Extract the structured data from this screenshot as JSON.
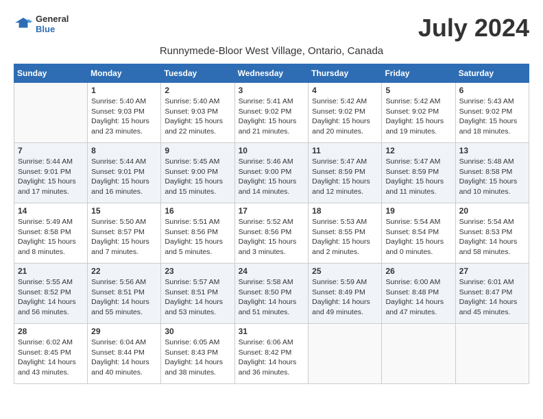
{
  "header": {
    "logo_line1": "General",
    "logo_line2": "Blue",
    "title": "July 2024",
    "subtitle": "Runnymede-Bloor West Village, Ontario, Canada"
  },
  "days_of_week": [
    "Sunday",
    "Monday",
    "Tuesday",
    "Wednesday",
    "Thursday",
    "Friday",
    "Saturday"
  ],
  "weeks": [
    [
      {
        "num": "",
        "info": ""
      },
      {
        "num": "1",
        "info": "Sunrise: 5:40 AM\nSunset: 9:03 PM\nDaylight: 15 hours\nand 23 minutes."
      },
      {
        "num": "2",
        "info": "Sunrise: 5:40 AM\nSunset: 9:03 PM\nDaylight: 15 hours\nand 22 minutes."
      },
      {
        "num": "3",
        "info": "Sunrise: 5:41 AM\nSunset: 9:02 PM\nDaylight: 15 hours\nand 21 minutes."
      },
      {
        "num": "4",
        "info": "Sunrise: 5:42 AM\nSunset: 9:02 PM\nDaylight: 15 hours\nand 20 minutes."
      },
      {
        "num": "5",
        "info": "Sunrise: 5:42 AM\nSunset: 9:02 PM\nDaylight: 15 hours\nand 19 minutes."
      },
      {
        "num": "6",
        "info": "Sunrise: 5:43 AM\nSunset: 9:02 PM\nDaylight: 15 hours\nand 18 minutes."
      }
    ],
    [
      {
        "num": "7",
        "info": "Sunrise: 5:44 AM\nSunset: 9:01 PM\nDaylight: 15 hours\nand 17 minutes."
      },
      {
        "num": "8",
        "info": "Sunrise: 5:44 AM\nSunset: 9:01 PM\nDaylight: 15 hours\nand 16 minutes."
      },
      {
        "num": "9",
        "info": "Sunrise: 5:45 AM\nSunset: 9:00 PM\nDaylight: 15 hours\nand 15 minutes."
      },
      {
        "num": "10",
        "info": "Sunrise: 5:46 AM\nSunset: 9:00 PM\nDaylight: 15 hours\nand 14 minutes."
      },
      {
        "num": "11",
        "info": "Sunrise: 5:47 AM\nSunset: 8:59 PM\nDaylight: 15 hours\nand 12 minutes."
      },
      {
        "num": "12",
        "info": "Sunrise: 5:47 AM\nSunset: 8:59 PM\nDaylight: 15 hours\nand 11 minutes."
      },
      {
        "num": "13",
        "info": "Sunrise: 5:48 AM\nSunset: 8:58 PM\nDaylight: 15 hours\nand 10 minutes."
      }
    ],
    [
      {
        "num": "14",
        "info": "Sunrise: 5:49 AM\nSunset: 8:58 PM\nDaylight: 15 hours\nand 8 minutes."
      },
      {
        "num": "15",
        "info": "Sunrise: 5:50 AM\nSunset: 8:57 PM\nDaylight: 15 hours\nand 7 minutes."
      },
      {
        "num": "16",
        "info": "Sunrise: 5:51 AM\nSunset: 8:56 PM\nDaylight: 15 hours\nand 5 minutes."
      },
      {
        "num": "17",
        "info": "Sunrise: 5:52 AM\nSunset: 8:56 PM\nDaylight: 15 hours\nand 3 minutes."
      },
      {
        "num": "18",
        "info": "Sunrise: 5:53 AM\nSunset: 8:55 PM\nDaylight: 15 hours\nand 2 minutes."
      },
      {
        "num": "19",
        "info": "Sunrise: 5:54 AM\nSunset: 8:54 PM\nDaylight: 15 hours\nand 0 minutes."
      },
      {
        "num": "20",
        "info": "Sunrise: 5:54 AM\nSunset: 8:53 PM\nDaylight: 14 hours\nand 58 minutes."
      }
    ],
    [
      {
        "num": "21",
        "info": "Sunrise: 5:55 AM\nSunset: 8:52 PM\nDaylight: 14 hours\nand 56 minutes."
      },
      {
        "num": "22",
        "info": "Sunrise: 5:56 AM\nSunset: 8:51 PM\nDaylight: 14 hours\nand 55 minutes."
      },
      {
        "num": "23",
        "info": "Sunrise: 5:57 AM\nSunset: 8:51 PM\nDaylight: 14 hours\nand 53 minutes."
      },
      {
        "num": "24",
        "info": "Sunrise: 5:58 AM\nSunset: 8:50 PM\nDaylight: 14 hours\nand 51 minutes."
      },
      {
        "num": "25",
        "info": "Sunrise: 5:59 AM\nSunset: 8:49 PM\nDaylight: 14 hours\nand 49 minutes."
      },
      {
        "num": "26",
        "info": "Sunrise: 6:00 AM\nSunset: 8:48 PM\nDaylight: 14 hours\nand 47 minutes."
      },
      {
        "num": "27",
        "info": "Sunrise: 6:01 AM\nSunset: 8:47 PM\nDaylight: 14 hours\nand 45 minutes."
      }
    ],
    [
      {
        "num": "28",
        "info": "Sunrise: 6:02 AM\nSunset: 8:45 PM\nDaylight: 14 hours\nand 43 minutes."
      },
      {
        "num": "29",
        "info": "Sunrise: 6:04 AM\nSunset: 8:44 PM\nDaylight: 14 hours\nand 40 minutes."
      },
      {
        "num": "30",
        "info": "Sunrise: 6:05 AM\nSunset: 8:43 PM\nDaylight: 14 hours\nand 38 minutes."
      },
      {
        "num": "31",
        "info": "Sunrise: 6:06 AM\nSunset: 8:42 PM\nDaylight: 14 hours\nand 36 minutes."
      },
      {
        "num": "",
        "info": ""
      },
      {
        "num": "",
        "info": ""
      },
      {
        "num": "",
        "info": ""
      }
    ]
  ]
}
